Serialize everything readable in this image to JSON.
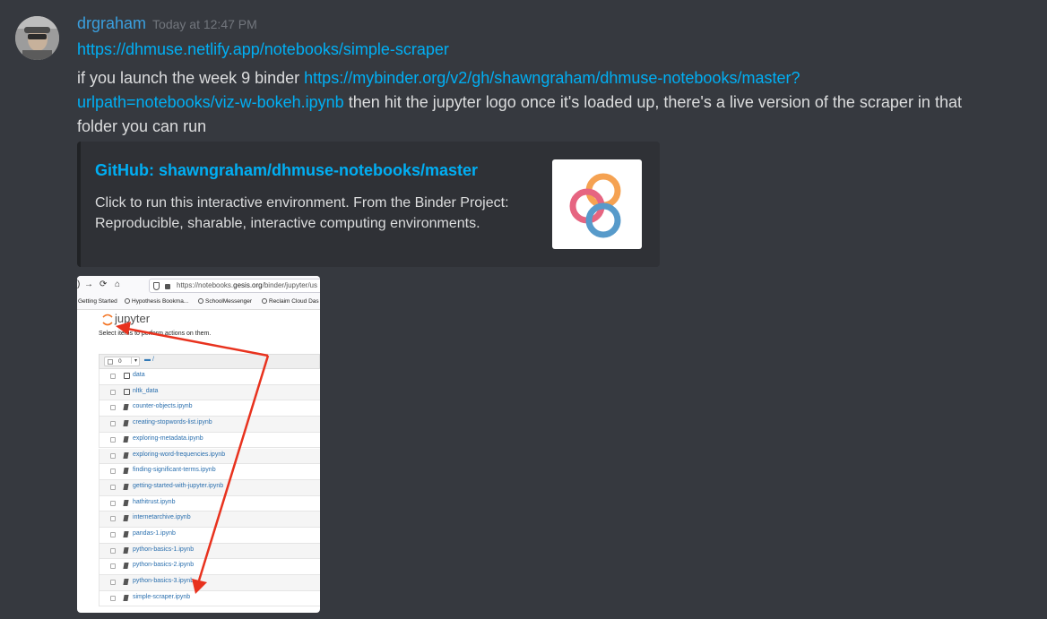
{
  "message": {
    "username": "drgraham",
    "timestamp": "Today at 12:47 PM",
    "link1": "https://dhmuse.netlify.app/notebooks/simple-scraper",
    "text_before_link": "if you launch the week 9 binder ",
    "link2_part1": "https://mybinder.org/v2/gh/shawngraham/dhmuse-notebooks/master?",
    "link2_part2": "urlpath=notebooks/viz-w-bokeh.ipynb",
    "text_after_link": " then hit the jupyter logo once it's loaded up, there's a live version of the scraper in that",
    "text_line3": "folder you can run"
  },
  "embed": {
    "title": "GitHub: shawngraham/dhmuse-notebooks/master",
    "description": "Click to run this interactive environment. From the Binder Project: Reproducible, sharable, interactive computing environments.",
    "thumbnail_icon": "binder-logo-icon"
  },
  "screenshot": {
    "url_prefix": "https://notebooks.",
    "url_domain": "gesis.org",
    "url_suffix": "/binder/jupyter/us",
    "bookmarks": [
      "Getting Started",
      "Hypothesis Bookma...",
      "SchoolMessenger",
      "Reclaim Cloud Das"
    ],
    "jupyter_label": "jupyter",
    "select_text": "Select items to perform actions on them.",
    "select_count": "0",
    "root_path": "/",
    "items": [
      {
        "name": "data",
        "kind": "folder"
      },
      {
        "name": "nltk_data",
        "kind": "folder"
      },
      {
        "name": "counter-objects.ipynb",
        "kind": "notebook"
      },
      {
        "name": "creating-stopwords-list.ipynb",
        "kind": "notebook"
      },
      {
        "name": "exploring-metadata.ipynb",
        "kind": "notebook"
      },
      {
        "name": "exploring-word-frequencies.ipynb",
        "kind": "notebook"
      },
      {
        "name": "finding-significant-terms.ipynb",
        "kind": "notebook"
      },
      {
        "name": "getting-started-with-jupyter.ipynb",
        "kind": "notebook"
      },
      {
        "name": "hathitrust.ipynb",
        "kind": "notebook"
      },
      {
        "name": "internetarchive.ipynb",
        "kind": "notebook"
      },
      {
        "name": "pandas-1.ipynb",
        "kind": "notebook"
      },
      {
        "name": "python-basics-1.ipynb",
        "kind": "notebook"
      },
      {
        "name": "python-basics-2.ipynb",
        "kind": "notebook"
      },
      {
        "name": "python-basics-3.ipynb",
        "kind": "notebook"
      },
      {
        "name": "simple-scraper.ipynb",
        "kind": "notebook"
      }
    ],
    "arrow_color": "#e8321e"
  }
}
